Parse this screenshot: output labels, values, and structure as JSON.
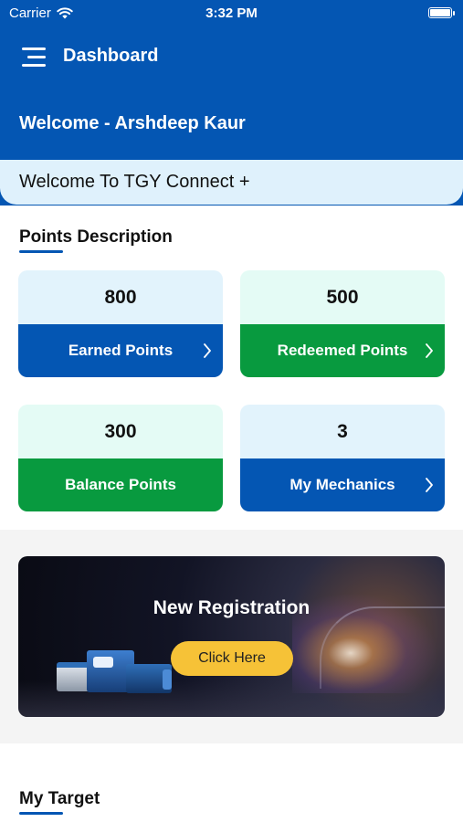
{
  "status_bar": {
    "carrier": "Carrier",
    "time": "3:32 PM"
  },
  "nav": {
    "title": "Dashboard"
  },
  "welcome_user": "Welcome - Arshdeep Kaur",
  "welcome_banner": "Welcome To TGY Connect +",
  "points_section": {
    "title": "Points Description",
    "cards": [
      {
        "value": "800",
        "label": "Earned Points"
      },
      {
        "value": "500",
        "label": "Redeemed Points"
      },
      {
        "value": "300",
        "label": "Balance Points"
      },
      {
        "value": "3",
        "label": "My Mechanics"
      }
    ]
  },
  "promo": {
    "title": "New Registration",
    "button": "Click Here"
  },
  "target_section": {
    "title": "My Target"
  },
  "colors": {
    "primary": "#0456b3",
    "green": "#089a3f",
    "accent": "#f6c237"
  }
}
